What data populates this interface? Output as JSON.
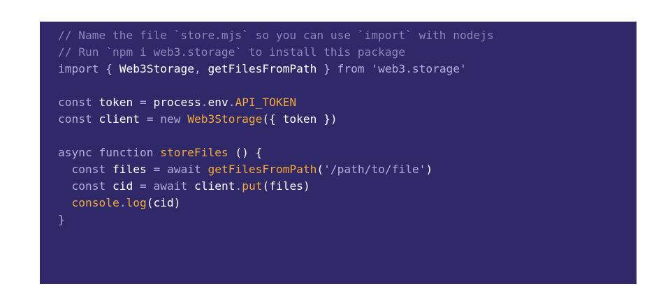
{
  "colors": {
    "panel_background": "#2f2869",
    "page_background": "#ffffff",
    "comment": "#8d86ba",
    "keyword": "#b2aedb",
    "identifier": "#ffffff",
    "function_call": "#f2a93b"
  },
  "code": {
    "lines": [
      [
        {
          "text": "// Name the file `store.mjs` so you can use `import` with nodejs",
          "type": "comment"
        }
      ],
      [
        {
          "text": "// Run `npm i web3.storage` to install this package",
          "type": "comment"
        }
      ],
      [
        {
          "text": "import",
          "type": "keyword"
        },
        {
          "text": " { ",
          "type": "punct"
        },
        {
          "text": "Web3Storage",
          "type": "ident"
        },
        {
          "text": ", ",
          "type": "punct"
        },
        {
          "text": "getFilesFromPath",
          "type": "ident"
        },
        {
          "text": " } ",
          "type": "punct"
        },
        {
          "text": "from",
          "type": "keyword"
        },
        {
          "text": " ",
          "type": "punct"
        },
        {
          "text": "'web3.storage'",
          "type": "string"
        }
      ],
      [],
      [
        {
          "text": "const",
          "type": "keyword"
        },
        {
          "text": " ",
          "type": "punct"
        },
        {
          "text": "token",
          "type": "ident"
        },
        {
          "text": " = ",
          "type": "operator"
        },
        {
          "text": "process",
          "type": "ident"
        },
        {
          "text": ".",
          "type": "punct"
        },
        {
          "text": "env",
          "type": "ident"
        },
        {
          "text": ".",
          "type": "punct"
        },
        {
          "text": "API_TOKEN",
          "type": "func"
        }
      ],
      [
        {
          "text": "const",
          "type": "keyword"
        },
        {
          "text": " ",
          "type": "punct"
        },
        {
          "text": "client",
          "type": "ident"
        },
        {
          "text": " = ",
          "type": "operator"
        },
        {
          "text": "new",
          "type": "keyword"
        },
        {
          "text": " ",
          "type": "punct"
        },
        {
          "text": "Web3Storage",
          "type": "func"
        },
        {
          "text": "({ ",
          "type": "paren"
        },
        {
          "text": "token",
          "type": "ident"
        },
        {
          "text": " })",
          "type": "paren"
        }
      ],
      [],
      [
        {
          "text": "async",
          "type": "keyword"
        },
        {
          "text": " ",
          "type": "punct"
        },
        {
          "text": "function",
          "type": "keyword"
        },
        {
          "text": " ",
          "type": "punct"
        },
        {
          "text": "storeFiles",
          "type": "func"
        },
        {
          "text": " () {",
          "type": "paren"
        }
      ],
      [
        {
          "text": "  ",
          "type": "punct"
        },
        {
          "text": "const",
          "type": "keyword"
        },
        {
          "text": " ",
          "type": "punct"
        },
        {
          "text": "files",
          "type": "ident"
        },
        {
          "text": " = ",
          "type": "operator"
        },
        {
          "text": "await",
          "type": "keyword"
        },
        {
          "text": " ",
          "type": "punct"
        },
        {
          "text": "getFilesFromPath",
          "type": "func"
        },
        {
          "text": "(",
          "type": "paren"
        },
        {
          "text": "'/path/to/file'",
          "type": "string"
        },
        {
          "text": ")",
          "type": "paren"
        }
      ],
      [
        {
          "text": "  ",
          "type": "punct"
        },
        {
          "text": "const",
          "type": "keyword"
        },
        {
          "text": " ",
          "type": "punct"
        },
        {
          "text": "cid",
          "type": "ident"
        },
        {
          "text": " = ",
          "type": "operator"
        },
        {
          "text": "await",
          "type": "keyword"
        },
        {
          "text": " ",
          "type": "punct"
        },
        {
          "text": "client",
          "type": "ident"
        },
        {
          "text": ".",
          "type": "punct"
        },
        {
          "text": "put",
          "type": "func"
        },
        {
          "text": "(",
          "type": "paren"
        },
        {
          "text": "files",
          "type": "ident"
        },
        {
          "text": ")",
          "type": "paren"
        }
      ],
      [
        {
          "text": "  ",
          "type": "punct"
        },
        {
          "text": "console",
          "type": "func"
        },
        {
          "text": ".",
          "type": "punct"
        },
        {
          "text": "log",
          "type": "func"
        },
        {
          "text": "(",
          "type": "paren"
        },
        {
          "text": "cid",
          "type": "ident"
        },
        {
          "text": ")",
          "type": "paren"
        }
      ],
      [
        {
          "text": "}",
          "type": "punct"
        }
      ]
    ]
  }
}
